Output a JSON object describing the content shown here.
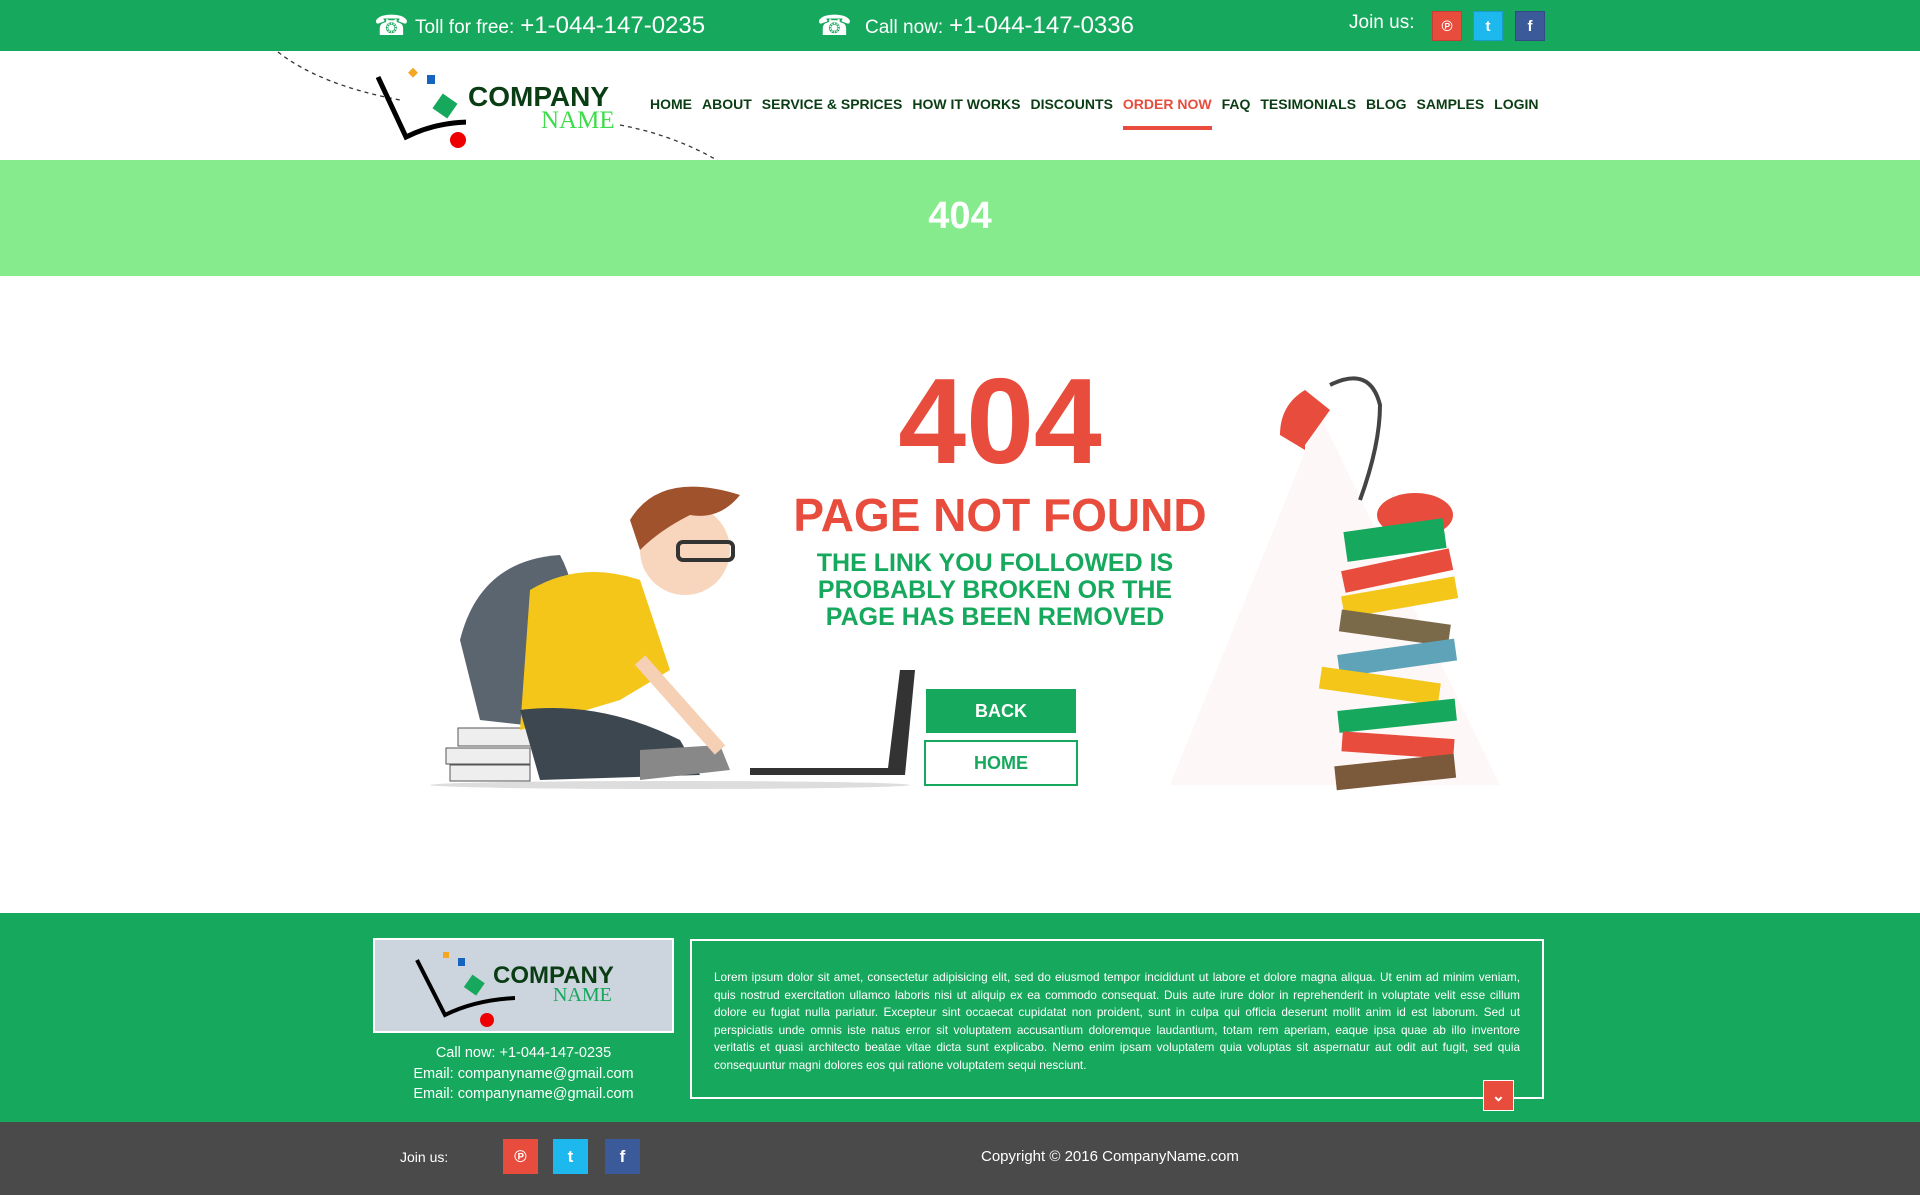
{
  "topbar": {
    "toll_label": "Toll for free:",
    "toll_number": "+1-044-147-0235",
    "call_label": "Call now:",
    "call_number": "+1-044-147-0336",
    "join_label": "Join us:",
    "social": {
      "pinterest": "℗",
      "twitter": "t",
      "facebook": "f"
    }
  },
  "logo": {
    "company": "COMPANY",
    "name": "NAME"
  },
  "nav": [
    "HOME",
    "ABOUT",
    "SERVICE & SPRICES",
    "HOW IT WORKS",
    "DISCOUNTS",
    "ORDER NOW",
    "FAQ",
    "TESIMONIALS",
    "BLOG",
    "SAMPLES",
    "LOGIN"
  ],
  "nav_active": "ORDER NOW",
  "banner": {
    "title": "404"
  },
  "error": {
    "code": "404",
    "title": "PAGE NOT FOUND",
    "message": "THE LINK YOU FOLLOWED IS PROBABLY BROKEN OR THE PAGE HAS BEEN REMOVED",
    "back_label": "BACK",
    "home_label": "HOME"
  },
  "footer": {
    "call": "Call now: +1-044-147-0235",
    "email1": "Email: companyname@gmail.com",
    "email2": "Email: companyname@gmail.com",
    "text": "Lorem ipsum dolor sit amet, consectetur adipisicing elit, sed do eiusmod tempor incididunt ut labore et dolore magna aliqua. Ut enim ad minim veniam, quis nostrud exercitation ullamco laboris nisi ut aliquip ex ea commodo consequat. Duis aute irure dolor in reprehenderit in voluptate velit esse cillum dolore eu fugiat nulla pariatur. Excepteur sint occaecat cupidatat non proident, sunt in culpa qui officia deserunt mollit anim id est laborum. Sed ut perspiciatis unde omnis iste natus error sit voluptatem accusantium doloremque laudantium, totam rem aperiam, eaque ipsa quae ab illo inventore veritatis et quasi architecto beatae vitae dicta sunt explicabo. Nemo enim ipsam voluptatem quia voluptas sit aspernatur aut odit aut fugit, sed quia consequuntur magni dolores eos qui ratione voluptatem sequi nesciunt.",
    "join_label": "Join us:",
    "copyright": "Copyright © 2016 CompanyName.com"
  },
  "colors": {
    "green": "#16a85c",
    "light_green": "#86eb8d",
    "red": "#e84c3d",
    "dark": "#4a4a4a"
  }
}
